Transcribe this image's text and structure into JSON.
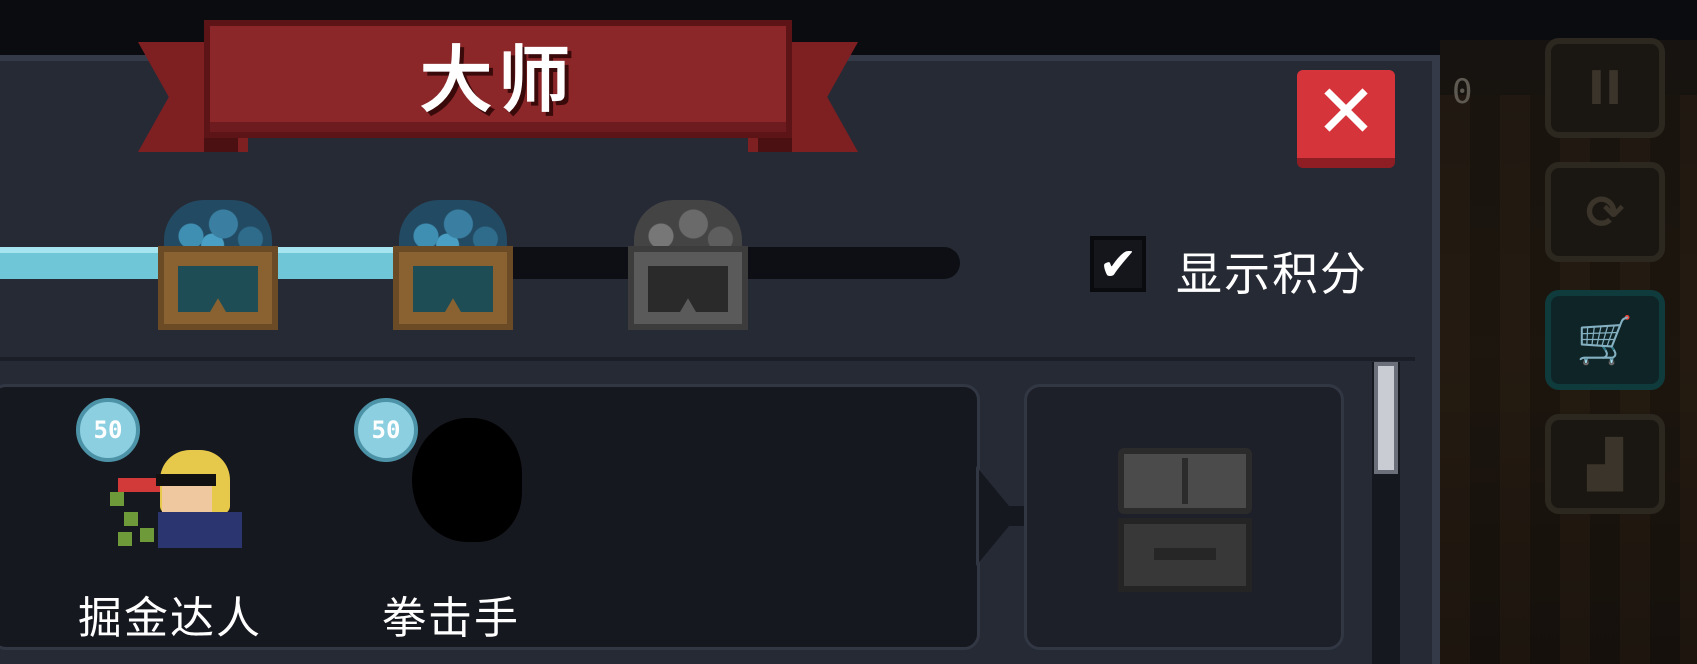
{
  "banner": {
    "title": "大师"
  },
  "close_button": {
    "icon": "close-icon"
  },
  "progress": {
    "fill_fraction": 0.41,
    "chests": [
      {
        "state": "unlocked",
        "icon": "gem-chest-icon"
      },
      {
        "state": "unlocked",
        "icon": "gem-chest-icon"
      },
      {
        "state": "locked",
        "icon": "gem-chest-icon"
      }
    ]
  },
  "show_points": {
    "label": "显示积分",
    "checked": true
  },
  "skins": [
    {
      "name": "掘金达人",
      "points": "50"
    },
    {
      "name": "拳击手",
      "points": "50"
    }
  ],
  "hud": {
    "counter": "0"
  },
  "colors": {
    "banner": "#8b2629",
    "close": "#d6343b",
    "progress_fill": "#6fc6d6",
    "panel": "#262a35"
  }
}
